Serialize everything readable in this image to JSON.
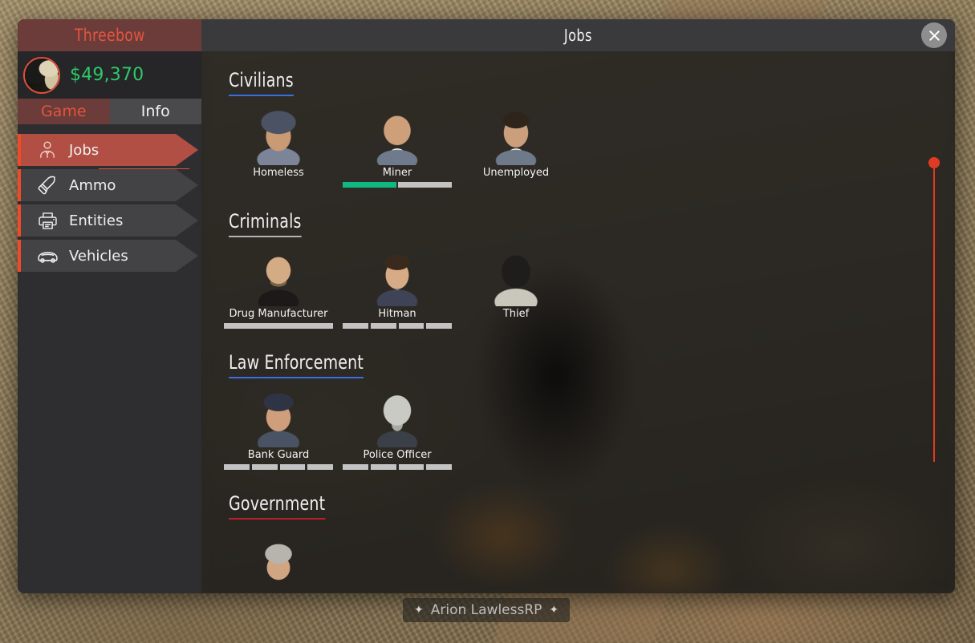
{
  "window": {
    "player_name": "Threebow",
    "money": "$49,370",
    "title": "Jobs",
    "close_icon": "close-icon",
    "avatar_icon": "avatar"
  },
  "tabs": [
    {
      "label": "Game",
      "active": true
    },
    {
      "label": "Info",
      "active": false
    }
  ],
  "nav": {
    "items": [
      {
        "label": "Jobs",
        "icon": "person-tie-icon",
        "active": true
      },
      {
        "label": "Ammo",
        "icon": "bullet-icon",
        "active": false
      },
      {
        "label": "Entities",
        "icon": "printer-icon",
        "active": false
      },
      {
        "label": "Vehicles",
        "icon": "car-icon",
        "active": false
      }
    ]
  },
  "sections": [
    {
      "title": "Civilians",
      "accent": "#3a6fe0",
      "jobs": [
        {
          "name": "Homeless",
          "portrait": "p-homeless",
          "bar": null
        },
        {
          "name": "Miner",
          "portrait": "p-miner",
          "bar": {
            "type": "progress",
            "segments": 2,
            "filled": 1
          }
        },
        {
          "name": "Unemployed",
          "portrait": "p-unemployed",
          "bar": null
        }
      ]
    },
    {
      "title": "Criminals",
      "accent": "#b3b3b3",
      "jobs": [
        {
          "name": "Drug Manufacturer",
          "portrait": "p-drugmfg",
          "bar": {
            "type": "solid",
            "segments": 1,
            "filled": 0
          }
        },
        {
          "name": "Hitman",
          "portrait": "p-hitman",
          "bar": {
            "type": "segmented",
            "segments": 4,
            "filled": 0
          }
        },
        {
          "name": "Thief",
          "portrait": "p-thief",
          "bar": null
        }
      ]
    },
    {
      "title": "Law Enforcement",
      "accent": "#3a6fe0",
      "jobs": [
        {
          "name": "Bank Guard",
          "portrait": "p-bankguard",
          "bar": {
            "type": "segmented",
            "segments": 4,
            "filled": 0
          }
        },
        {
          "name": "Police Officer",
          "portrait": "p-police",
          "bar": {
            "type": "segmented",
            "segments": 4,
            "filled": 0
          }
        }
      ]
    },
    {
      "title": "Government",
      "accent": "#b9202c",
      "jobs": [
        {
          "name": "",
          "portrait": "p-govt",
          "bar": null
        }
      ]
    }
  ],
  "scrollbar": {
    "name": "vertical-scrollbar",
    "color": "#e03b22",
    "position_pct": 0
  },
  "watermark": {
    "text": "Arion LawlessRP",
    "spark": "✦"
  }
}
